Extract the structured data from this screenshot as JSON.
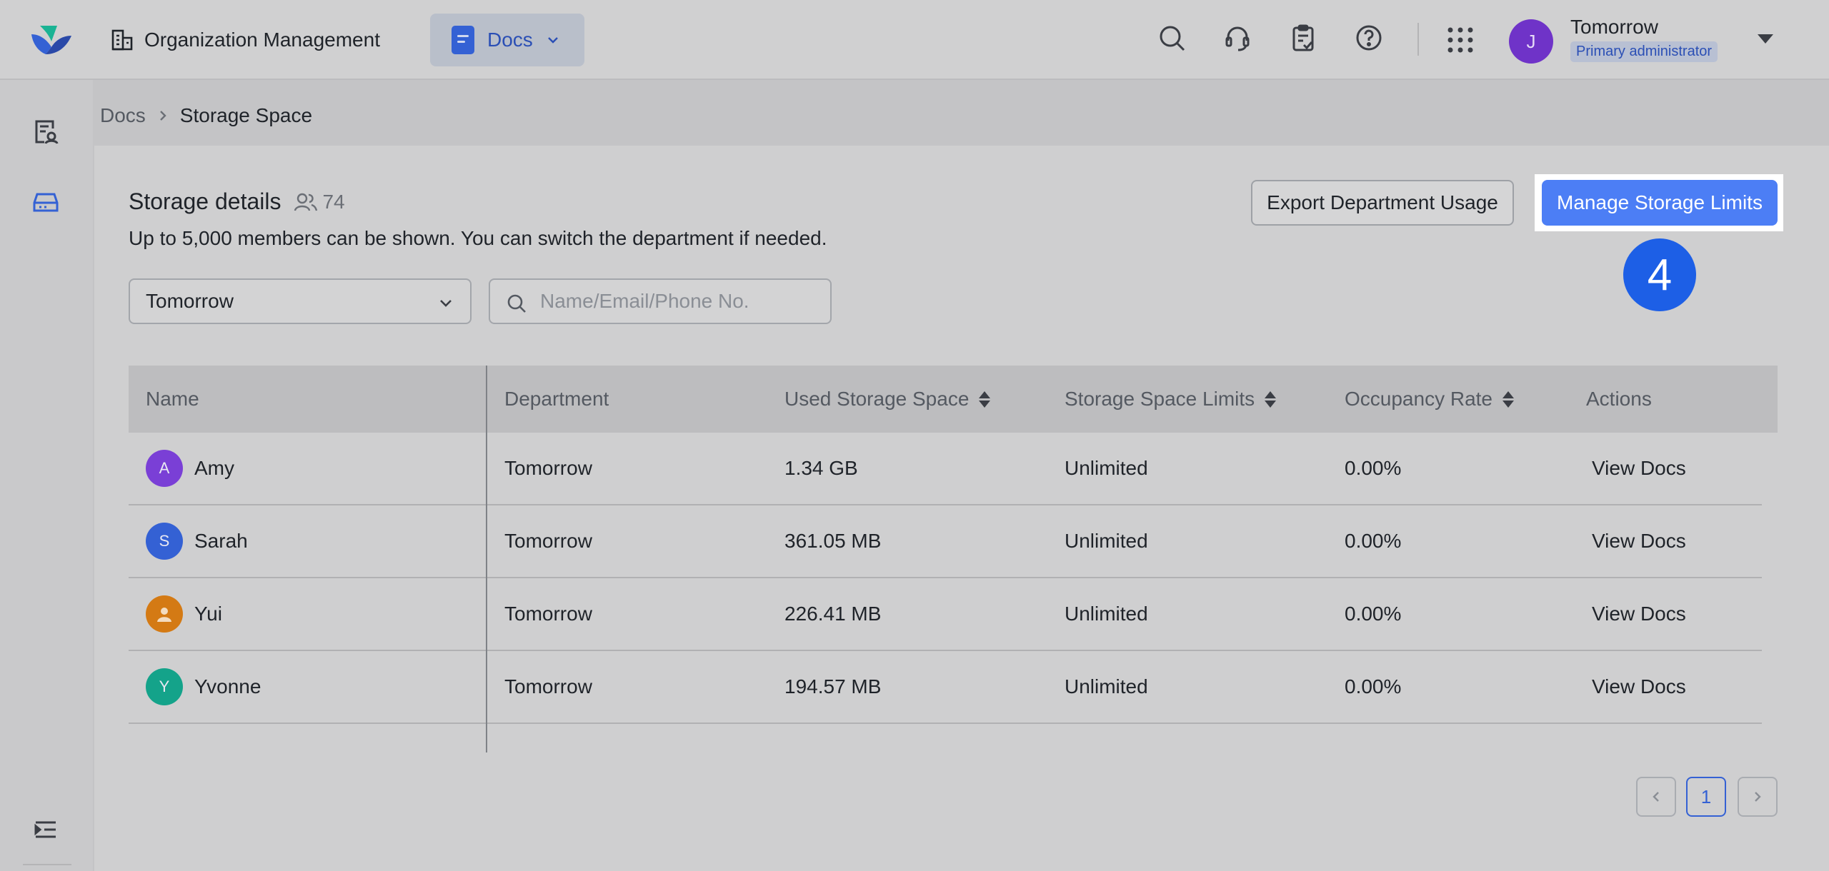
{
  "header": {
    "org_label": "Organization Management",
    "app_tab": "Docs",
    "user": {
      "initial": "J",
      "name": "Tomorrow",
      "role": "Primary administrator"
    },
    "icons": [
      "search-icon",
      "headset-icon",
      "clipboard-check-icon",
      "help-icon",
      "apps-grid-icon"
    ]
  },
  "breadcrumb": {
    "parent": "Docs",
    "current": "Storage Space"
  },
  "storage": {
    "title": "Storage details",
    "member_count": "74",
    "subtitle": "Up to 5,000 members can be shown. You can switch the department if needed.",
    "export_button": "Export Department Usage",
    "manage_button": "Manage Storage Limits",
    "step_badge": "4",
    "department_value": "Tomorrow",
    "search_placeholder": "Name/Email/Phone No."
  },
  "table": {
    "columns": [
      "Name",
      "Department",
      "Used Storage Space",
      "Storage Space Limits",
      "Occupancy Rate",
      "Actions"
    ],
    "rows": [
      {
        "initial": "A",
        "name": "Amy",
        "department": "Tomorrow",
        "used": "1.34 GB",
        "limit": "Unlimited",
        "rate": "0.00%",
        "action": "View Docs",
        "avatar_color": "#7a3fd6"
      },
      {
        "initial": "S",
        "name": "Sarah",
        "department": "Tomorrow",
        "used": "361.05 MB",
        "limit": "Unlimited",
        "rate": "0.00%",
        "action": "View Docs",
        "avatar_color": "#3461d4"
      },
      {
        "initial": "",
        "name": "Yui",
        "department": "Tomorrow",
        "used": "226.41 MB",
        "limit": "Unlimited",
        "rate": "0.00%",
        "action": "View Docs",
        "avatar_color": "#d47a14"
      },
      {
        "initial": "Y",
        "name": "Yvonne",
        "department": "Tomorrow",
        "used": "194.57 MB",
        "limit": "Unlimited",
        "rate": "0.00%",
        "action": "View Docs",
        "avatar_color": "#14a38a"
      }
    ]
  },
  "pagination": {
    "current": "1"
  },
  "colors": {
    "accent": "#4c7ef5",
    "badge": "#1d5fe6",
    "avatar": "#6f33c8"
  }
}
